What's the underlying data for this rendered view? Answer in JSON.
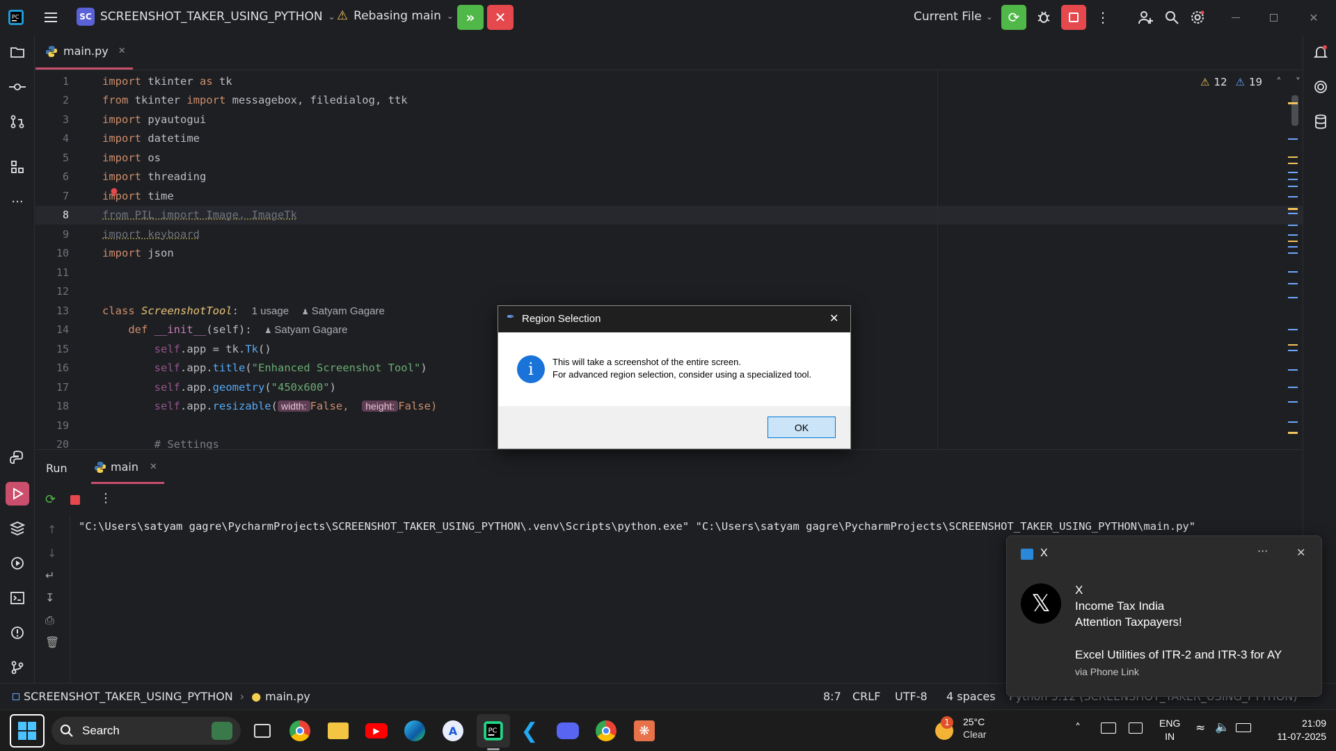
{
  "titlebar": {
    "project_badge": "SC",
    "project_name": "SCREENSHOT_TAKER_USING_PYTHON",
    "vcs_status": "Rebasing main",
    "run_config": "Current File"
  },
  "tabs": [
    {
      "label": "main.py"
    }
  ],
  "editor": {
    "warnings": "12",
    "weak_warnings": "19",
    "lines": [
      {
        "n": "1"
      },
      {
        "n": "2"
      },
      {
        "n": "3"
      },
      {
        "n": "4"
      },
      {
        "n": "5"
      },
      {
        "n": "6"
      },
      {
        "n": "7"
      },
      {
        "n": "8"
      },
      {
        "n": "9"
      },
      {
        "n": "10"
      },
      {
        "n": "11"
      },
      {
        "n": "12"
      },
      {
        "n": "13"
      },
      {
        "n": "14"
      },
      {
        "n": "15"
      },
      {
        "n": "16"
      },
      {
        "n": "17"
      },
      {
        "n": "18"
      },
      {
        "n": "19"
      },
      {
        "n": "20"
      }
    ],
    "code": {
      "l1": {
        "k": "import",
        "a": " tkinter ",
        "k2": "as",
        "b": " tk"
      },
      "l2": {
        "k": "from",
        "a": " tkinter ",
        "k2": "import",
        "b": " messagebox, filedialog, ttk"
      },
      "l3": {
        "k": "import",
        "a": " pyautogui"
      },
      "l4": {
        "k": "import",
        "a": " datetime"
      },
      "l5": {
        "k": "import",
        "a": " os"
      },
      "l6": {
        "k": "import",
        "a": " threading"
      },
      "l7": {
        "k": "import",
        "a": " time"
      },
      "l8": {
        "text": "from PIL import Image, ImageTk"
      },
      "l9": {
        "text": "import keyboard"
      },
      "l10": {
        "k": "import",
        "a": " json"
      },
      "l13": {
        "k": "class",
        "name": "ScreenshotTool",
        "colon": ":",
        "usage": "1 usage",
        "author": "Satyam Gagare"
      },
      "l14": {
        "k": "def",
        "name": "__init__",
        "args": "(self):",
        "author": "Satyam Gagare"
      },
      "l15": {
        "self": "self",
        "a": ".app = tk.",
        "fn": "Tk",
        "b": "()"
      },
      "l16": {
        "self": "self",
        "a": ".app.",
        "fn": "title",
        "b": "(",
        "str": "\"Enhanced Screenshot Tool\"",
        "c": ")"
      },
      "l17": {
        "self": "self",
        "a": ".app.",
        "fn": "geometry",
        "b": "(",
        "str": "\"450x600\"",
        "c": ")"
      },
      "l18": {
        "self": "self",
        "a": ".app.",
        "fn": "resizable",
        "b": "(",
        "p1": "width:",
        "v1": "False, ",
        "p2": "height:",
        "v2": "False)"
      },
      "l20": {
        "text": "# Settings"
      }
    }
  },
  "run": {
    "title": "Run",
    "tab": "main",
    "command": "\"C:\\Users\\satyam gagre\\PycharmProjects\\SCREENSHOT_TAKER_USING_PYTHON\\.venv\\Scripts\\python.exe\" \"C:\\Users\\satyam gagre\\PycharmProjects\\SCREENSHOT_TAKER_USING_PYTHON\\main.py\""
  },
  "status": {
    "project": "SCREENSHOT_TAKER_USING_PYTHON",
    "file": "main.py",
    "position": "8:7",
    "line_sep": "CRLF",
    "encoding": "UTF-8",
    "indent": "4 spaces",
    "interpreter": "Python 3.12 (SCREENSHOT_TAKER_USING_PYTHON)"
  },
  "dialog": {
    "title": "Region Selection",
    "line1": "This will take a screenshot of the entire screen.",
    "line2": "For advanced region selection, consider using a specialized tool.",
    "ok": "OK",
    "info_glyph": "i"
  },
  "toast": {
    "app": "X",
    "more": "···",
    "sender": "X",
    "line1": "Income Tax India",
    "line2": "Attention Taxpayers!",
    "line3": "Excel Utilities of ITR-2 and ITR-3 for AY",
    "via": "via Phone Link"
  },
  "taskbar": {
    "search": "Search",
    "weather_temp": "25°C",
    "weather_desc": "Clear",
    "weather_badge": "1",
    "lang1": "ENG",
    "lang2": "IN",
    "time": "21:09",
    "date": "11-07-2025"
  },
  "colors": {
    "accent": "#5b61d6",
    "run_green": "#4fb848",
    "stop_red": "#e5484d",
    "dialog_ok": "#cce4f7"
  }
}
